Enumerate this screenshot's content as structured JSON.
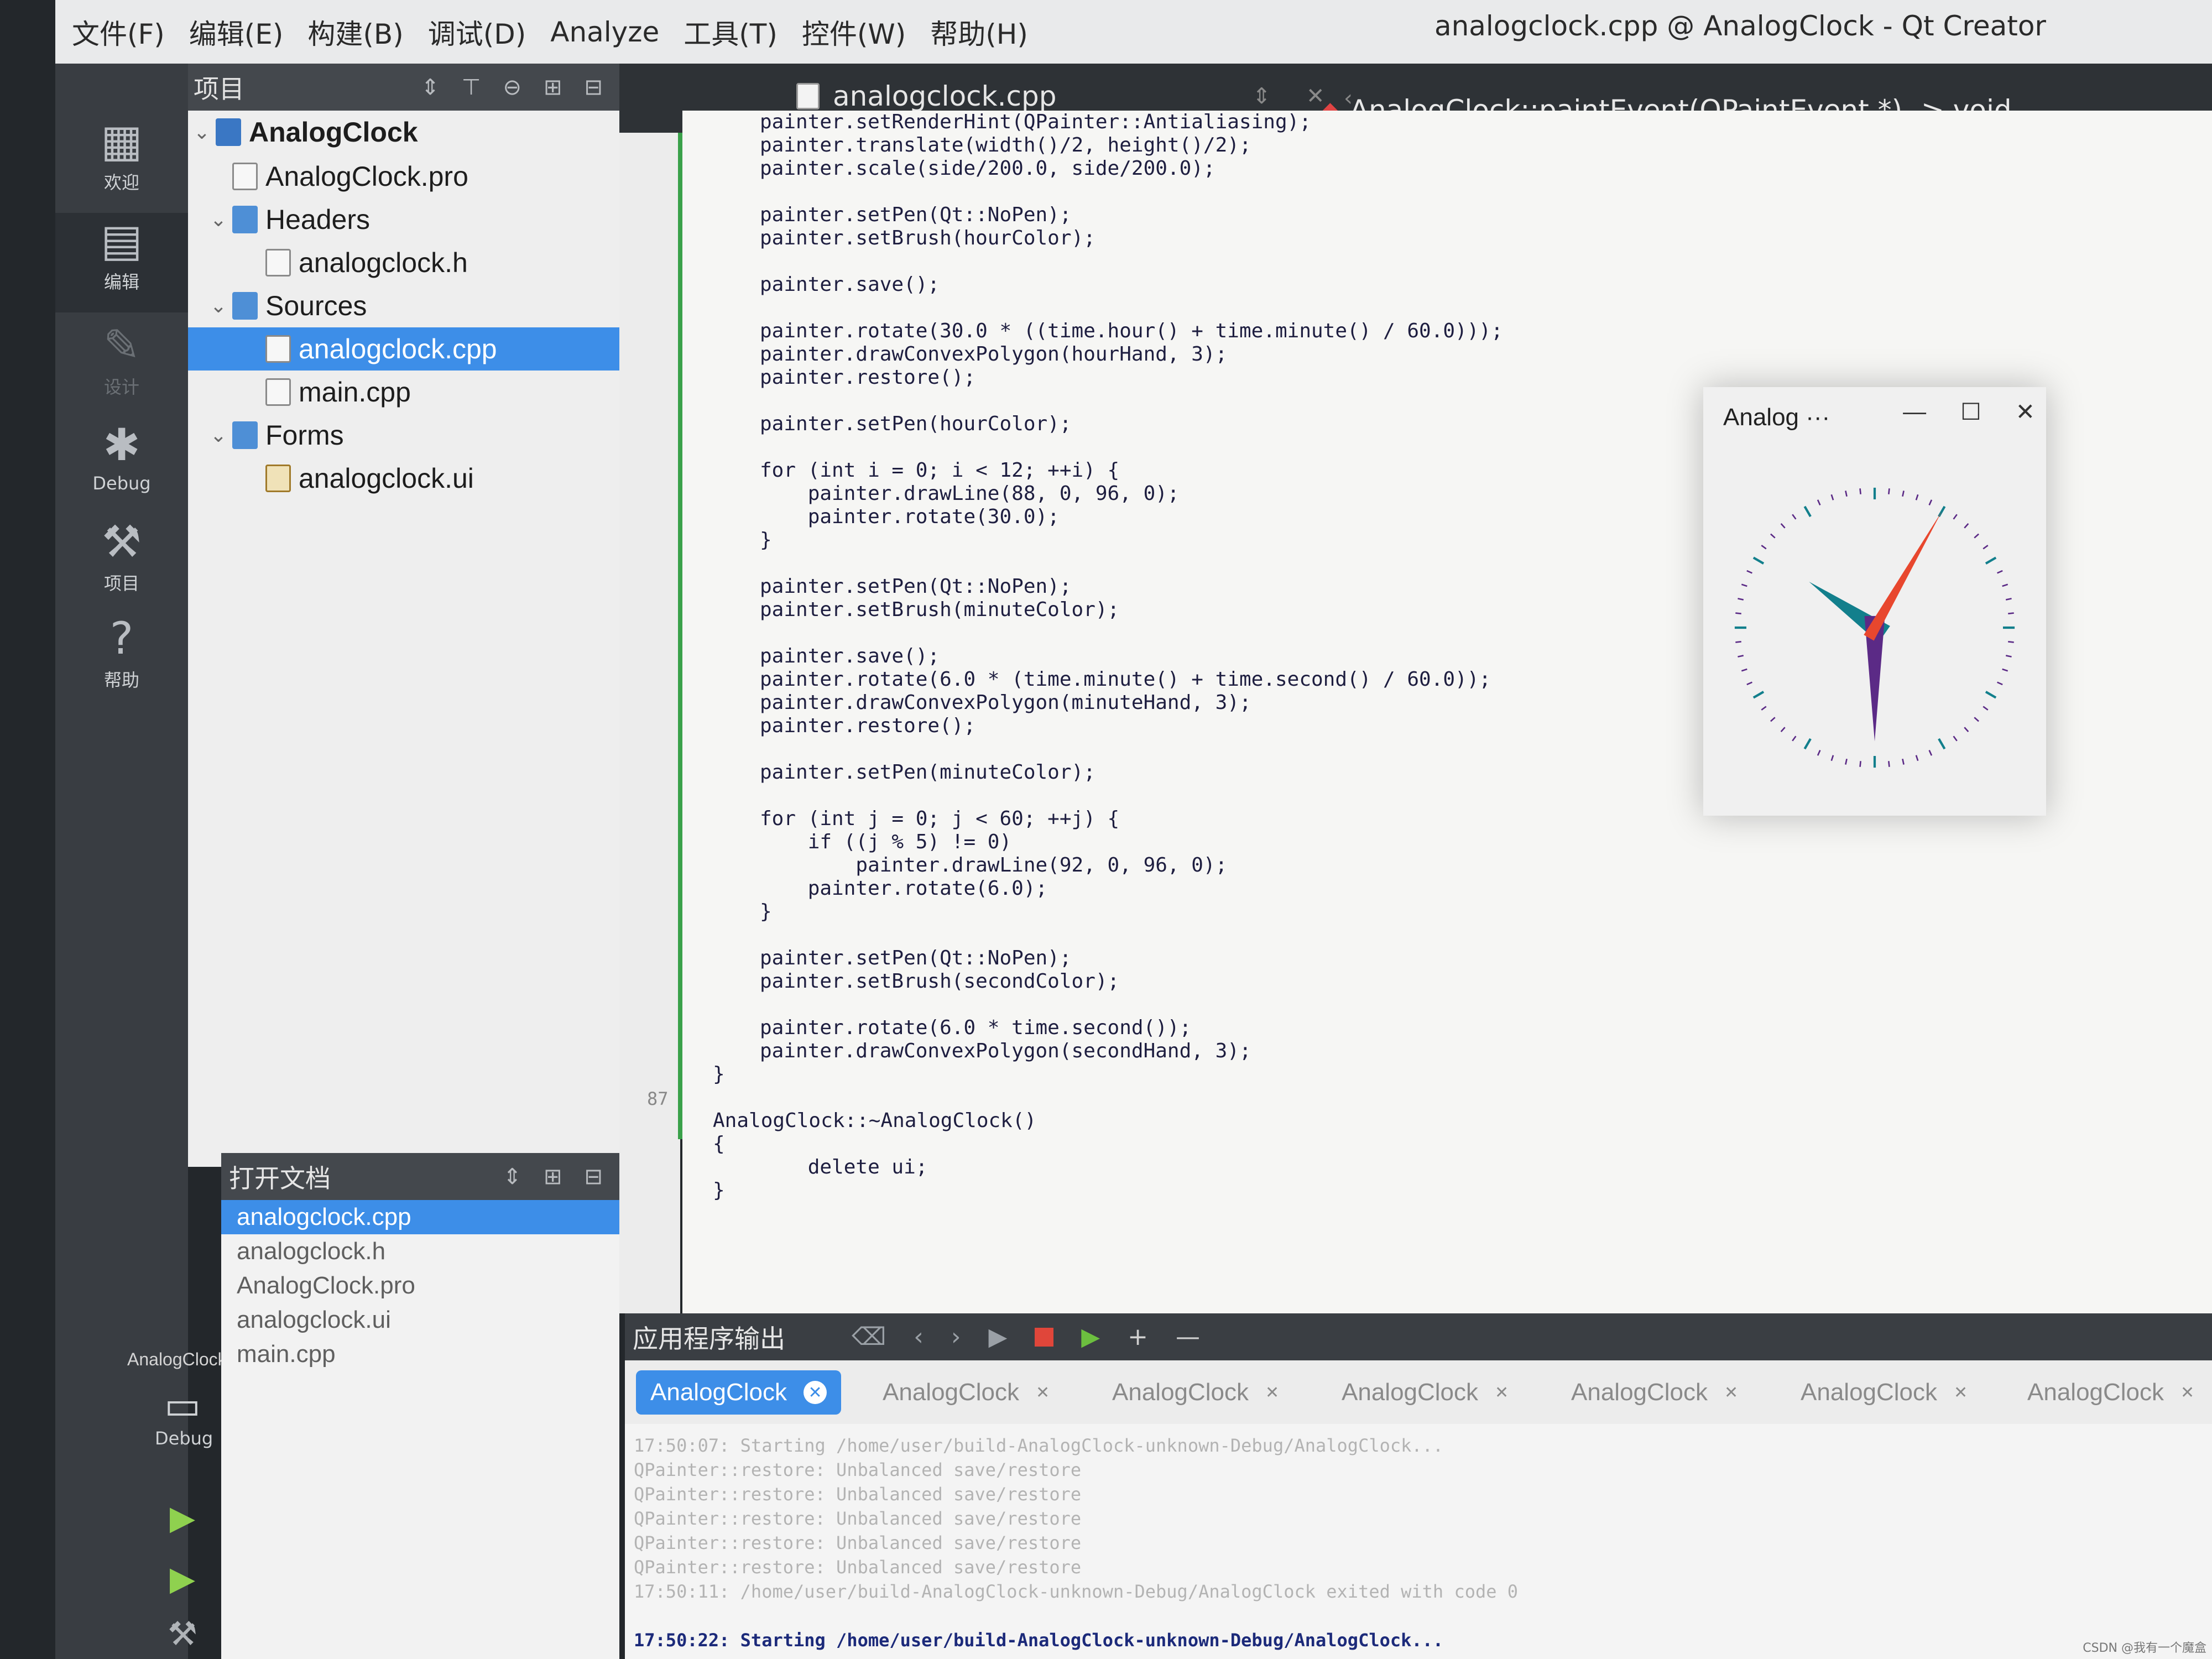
{
  "window": {
    "title": "analogclock.cpp @ AnalogClock - Qt Creator"
  },
  "menu": [
    "文件(F)",
    "编辑(E)",
    "构建(B)",
    "调试(D)",
    "Analyze",
    "工具(T)",
    "控件(W)",
    "帮助(H)"
  ],
  "modes": [
    {
      "label": "欢迎",
      "icon": "grid-icon"
    },
    {
      "label": "编辑",
      "icon": "document-icon"
    },
    {
      "label": "设计",
      "icon": "pencil-icon"
    },
    {
      "label": "Debug",
      "icon": "bug-icon"
    },
    {
      "label": "项目",
      "icon": "wrench-icon"
    },
    {
      "label": "帮助",
      "icon": "help-icon"
    }
  ],
  "project_pane": {
    "title": "项目",
    "tree": [
      {
        "label": "AnalogClock",
        "kind": "proj"
      },
      {
        "label": "AnalogClock.pro",
        "kind": "file"
      },
      {
        "label": "Headers",
        "kind": "folder"
      },
      {
        "label": "analogclock.h",
        "kind": "file"
      },
      {
        "label": "Sources",
        "kind": "folder"
      },
      {
        "label": "analogclock.cpp",
        "kind": "file",
        "selected": true
      },
      {
        "label": "main.cpp",
        "kind": "file"
      },
      {
        "label": "Forms",
        "kind": "folder"
      },
      {
        "label": "analogclock.ui",
        "kind": "ui"
      }
    ]
  },
  "open_docs": {
    "title": "打开文档",
    "items": [
      "analogclock.cpp",
      "analogclock.h",
      "AnalogClock.pro",
      "analogclock.ui",
      "main.cpp"
    ]
  },
  "editor": {
    "tab": "analogclock.cpp",
    "function": "AnalogClock::paintEvent(QPaintEvent *) -> void",
    "line_number": "87",
    "code": [
      "painter.setRenderHint(QPainter::Antialiasing);",
      "painter.translate(width()/2, height()/2);",
      "painter.scale(side/200.0, side/200.0);",
      "",
      "painter.setPen(Qt::NoPen);",
      "painter.setBrush(hourColor);",
      "",
      "painter.save();",
      "",
      "painter.rotate(30.0 * ((time.hour() + time.minute() / 60.0)));",
      "painter.drawConvexPolygon(hourHand, 3);",
      "painter.restore();",
      "",
      "painter.setPen(hourColor);",
      "",
      "for (int i = 0; i < 12; ++i) {",
      "    painter.drawLine(88, 0, 96, 0);",
      "    painter.rotate(30.0);",
      "}",
      "",
      "painter.setPen(Qt::NoPen);",
      "painter.setBrush(minuteColor);",
      "",
      "painter.save();",
      "painter.rotate(6.0 * (time.minute() + time.second() / 60.0));",
      "painter.drawConvexPolygon(minuteHand, 3);",
      "painter.restore();",
      "",
      "painter.setPen(minuteColor);",
      "",
      "for (int j = 0; j < 60; ++j) {",
      "    if ((j % 5) != 0)",
      "        painter.drawLine(92, 0, 96, 0);",
      "    painter.rotate(6.0);",
      "}",
      "",
      "painter.setPen(Qt::NoPen);",
      "painter.setBrush(secondColor);",
      "",
      "painter.rotate(6.0 * time.second());",
      "painter.drawConvexPolygon(secondHand, 3);",
      "}",
      "",
      "AnalogClock::~AnalogClock()",
      "{",
      "    delete ui;",
      "}"
    ]
  },
  "clock_window": {
    "title": "Analog ···",
    "hour_color": "#127f8c",
    "minute_color": "#5b2a86",
    "second_color": "#e8472e"
  },
  "output": {
    "title": "应用程序输出",
    "tabs": [
      "AnalogClock",
      "AnalogClock",
      "AnalogClock",
      "AnalogClock",
      "AnalogClock",
      "AnalogClock",
      "AnalogClock"
    ],
    "lines": [
      {
        "text": "17:50:07: Starting /home/user/build-AnalogClock-unknown-Debug/AnalogClock...",
        "strong": false
      },
      {
        "text": "QPainter::restore: Unbalanced save/restore",
        "strong": false
      },
      {
        "text": "QPainter::restore: Unbalanced save/restore",
        "strong": false
      },
      {
        "text": "QPainter::restore: Unbalanced save/restore",
        "strong": false
      },
      {
        "text": "QPainter::restore: Unbalanced save/restore",
        "strong": false
      },
      {
        "text": "QPainter::restore: Unbalanced save/restore",
        "strong": false
      },
      {
        "text": "17:50:11: /home/user/build-AnalogClock-unknown-Debug/AnalogClock exited with code 0",
        "strong": false
      },
      {
        "text": "",
        "strong": false
      },
      {
        "text": "17:50:22: Starting /home/user/build-AnalogClock-unknown-Debug/AnalogClock...",
        "strong": true
      }
    ]
  },
  "kit": {
    "label": "AnalogClock",
    "mode": "Debug"
  },
  "watermark": "CSDN @我有一个魔盒"
}
